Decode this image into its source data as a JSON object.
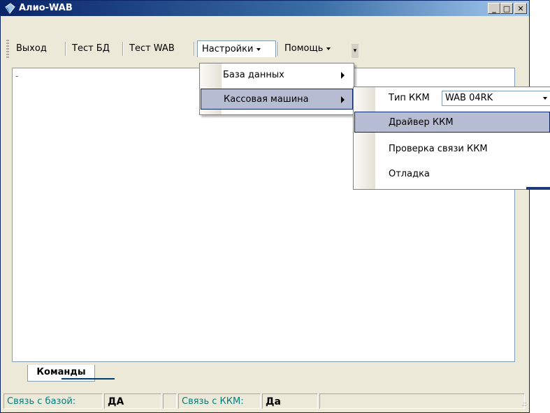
{
  "window": {
    "title": "Алио-WAB",
    "controls": {
      "minimize": "_",
      "maximize": "□",
      "close": "✕"
    }
  },
  "toolbar": {
    "items": [
      "Выход",
      "Тест БД",
      "Тест WAB",
      "Настройки",
      "Помощь"
    ]
  },
  "main": {
    "marker": "-"
  },
  "settings_menu": {
    "items": [
      "База данных",
      "Кассовая машина"
    ]
  },
  "cash_submenu": {
    "kkm_type_label": "Тип ККМ",
    "kkm_type_value": "WAB 04RK",
    "items": [
      "Драйвер ККМ",
      "Проверка связи ККМ",
      "Отладка"
    ]
  },
  "tabs": {
    "commands": "Команды"
  },
  "status": {
    "db_label": "Связь с базой:",
    "db_value": "ДА",
    "kkm_label": "Связь с ККМ:",
    "kkm_value": "Да"
  },
  "colors": {
    "titlebar": "#0a246a",
    "highlight": "#b6bdd2",
    "status_label": "#008080"
  }
}
